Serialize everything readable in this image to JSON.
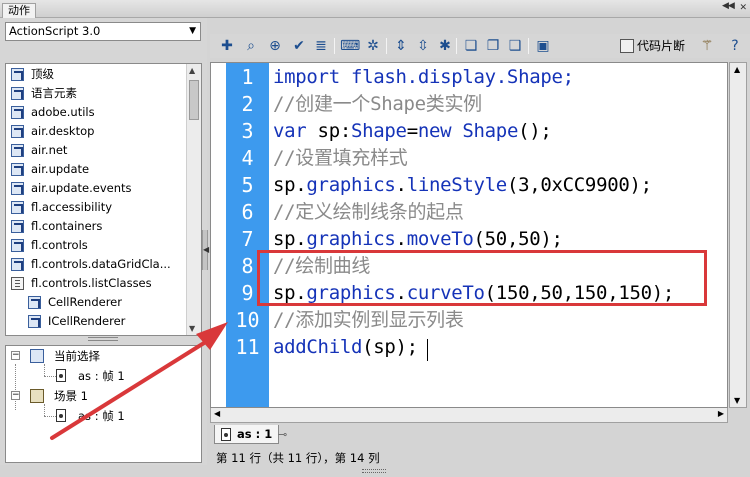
{
  "panel": {
    "title": "动作"
  },
  "left": {
    "version_select": "ActionScript 3.0",
    "tree_items": [
      {
        "label": "顶级",
        "icon": "package-icon"
      },
      {
        "label": "语言元素",
        "icon": "package-icon"
      },
      {
        "label": "adobe.utils",
        "icon": "package-icon"
      },
      {
        "label": "air.desktop",
        "icon": "package-icon"
      },
      {
        "label": "air.net",
        "icon": "package-icon"
      },
      {
        "label": "air.update",
        "icon": "package-icon"
      },
      {
        "label": "air.update.events",
        "icon": "package-icon"
      },
      {
        "label": "fl.accessibility",
        "icon": "package-icon"
      },
      {
        "label": "fl.containers",
        "icon": "package-icon"
      },
      {
        "label": "fl.controls",
        "icon": "package-icon"
      },
      {
        "label": "fl.controls.dataGridCla...",
        "icon": "package-icon"
      },
      {
        "label": "fl.controls.listClasses",
        "icon": "open-package-icon"
      },
      {
        "label": "CellRenderer",
        "icon": "class-icon"
      },
      {
        "label": "ICellRenderer",
        "icon": "class-icon"
      }
    ],
    "scene_tree": {
      "current_selection": "当前选择",
      "current_frame": "as : 帧 1",
      "scene": "场景 1",
      "scene_frame": "as : 帧 1"
    }
  },
  "toolbar": {
    "buttons": [
      "add-item-icon",
      "find-icon",
      "target-path-icon",
      "check-syntax-icon",
      "auto-format-icon",
      "code-hint-icon",
      "debug-options-icon",
      "collapse-between-braces-icon",
      "collapse-selection-icon",
      "expand-all-icon",
      "apply-block-comment-icon",
      "apply-line-comment-icon",
      "remove-comment-icon",
      "show-hide-toolbox-icon"
    ],
    "snippets_label": "代码片断",
    "wand_icon": "wand-icon",
    "help_icon": "help-icon"
  },
  "editor": {
    "line_numbers": [
      "1",
      "2",
      "3",
      "4",
      "5",
      "6",
      "7",
      "8",
      "9",
      "10",
      "11"
    ],
    "lines": [
      [
        {
          "t": "import",
          "c": "kw"
        },
        {
          "t": " flash.display.Shape;",
          "c": "kw"
        }
      ],
      [
        {
          "t": "//创建一个Shape类实例",
          "c": "cmt"
        }
      ],
      [
        {
          "t": "var",
          "c": "kw"
        },
        {
          "t": " sp:",
          "c": "plain"
        },
        {
          "t": "Shape",
          "c": "kw"
        },
        {
          "t": "=",
          "c": "plain"
        },
        {
          "t": "new",
          "c": "kw"
        },
        {
          "t": " ",
          "c": "plain"
        },
        {
          "t": "Shape",
          "c": "kw"
        },
        {
          "t": "();",
          "c": "plain"
        }
      ],
      [
        {
          "t": "//设置填充样式",
          "c": "cmt"
        }
      ],
      [
        {
          "t": "sp.",
          "c": "plain"
        },
        {
          "t": "graphics",
          "c": "kw"
        },
        {
          "t": ".",
          "c": "plain"
        },
        {
          "t": "lineStyle",
          "c": "kw"
        },
        {
          "t": "(3,0xCC9900);",
          "c": "plain"
        }
      ],
      [
        {
          "t": "//定义绘制线条的起点",
          "c": "cmt"
        }
      ],
      [
        {
          "t": "sp.",
          "c": "plain"
        },
        {
          "t": "graphics",
          "c": "kw"
        },
        {
          "t": ".",
          "c": "plain"
        },
        {
          "t": "moveTo",
          "c": "kw"
        },
        {
          "t": "(50,50);",
          "c": "plain"
        }
      ],
      [
        {
          "t": "//绘制曲线",
          "c": "cmt"
        }
      ],
      [
        {
          "t": "sp.",
          "c": "plain"
        },
        {
          "t": "graphics",
          "c": "kw"
        },
        {
          "t": ".",
          "c": "plain"
        },
        {
          "t": "curveTo",
          "c": "kw"
        },
        {
          "t": "(150,50,150,150);",
          "c": "plain"
        }
      ],
      [
        {
          "t": "//添加实例到显示列表",
          "c": "cmt"
        }
      ],
      [
        {
          "t": "addChild",
          "c": "kw"
        },
        {
          "t": "(sp);",
          "c": "plain"
        }
      ]
    ]
  },
  "bottom": {
    "doc_tab": "as : 1",
    "status": "第 11 行（共 11 行），第 14 列"
  },
  "colors": {
    "gutter": "#3d9aee",
    "keyword": "#1533b8",
    "comment": "#8a8a8a",
    "annotation": "#d9383a"
  }
}
